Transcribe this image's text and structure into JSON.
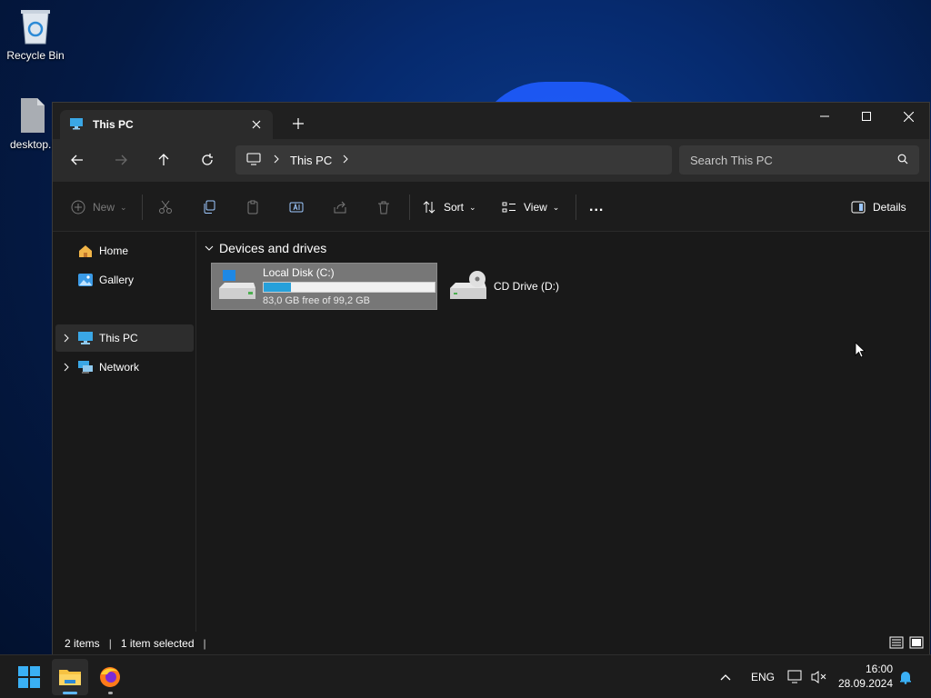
{
  "desktop": {
    "icons": [
      {
        "label": "Recycle Bin"
      },
      {
        "label": "desktop.i"
      }
    ]
  },
  "window": {
    "tab_title": "This PC",
    "nav": {
      "breadcrumb": [
        "This PC"
      ],
      "search_placeholder": "Search This PC"
    },
    "toolbar": {
      "new_label": "New",
      "sort_label": "Sort",
      "view_label": "View",
      "more_label": "...",
      "details_label": "Details"
    },
    "sidebar": {
      "items": [
        {
          "label": "Home",
          "icon": "home-icon"
        },
        {
          "label": "Gallery",
          "icon": "gallery-icon"
        },
        {
          "label": "This PC",
          "icon": "this-pc-icon",
          "selected": true
        },
        {
          "label": "Network",
          "icon": "network-icon"
        }
      ]
    },
    "content": {
      "group_title": "Devices and drives",
      "drives": [
        {
          "name": "Local Disk (C:)",
          "free_text": "83,0 GB free of 99,2 GB",
          "used_fraction": 0.16,
          "selected": true
        },
        {
          "name": "CD Drive (D:)"
        }
      ]
    },
    "status": {
      "items_count": "2 items",
      "selection": "1 item selected"
    }
  },
  "taskbar": {
    "language": "ENG",
    "time": "16:00",
    "date": "28.09.2024"
  },
  "colors": {
    "accent": "#26a0da",
    "window_bg": "#191919",
    "selection": "#777777"
  }
}
